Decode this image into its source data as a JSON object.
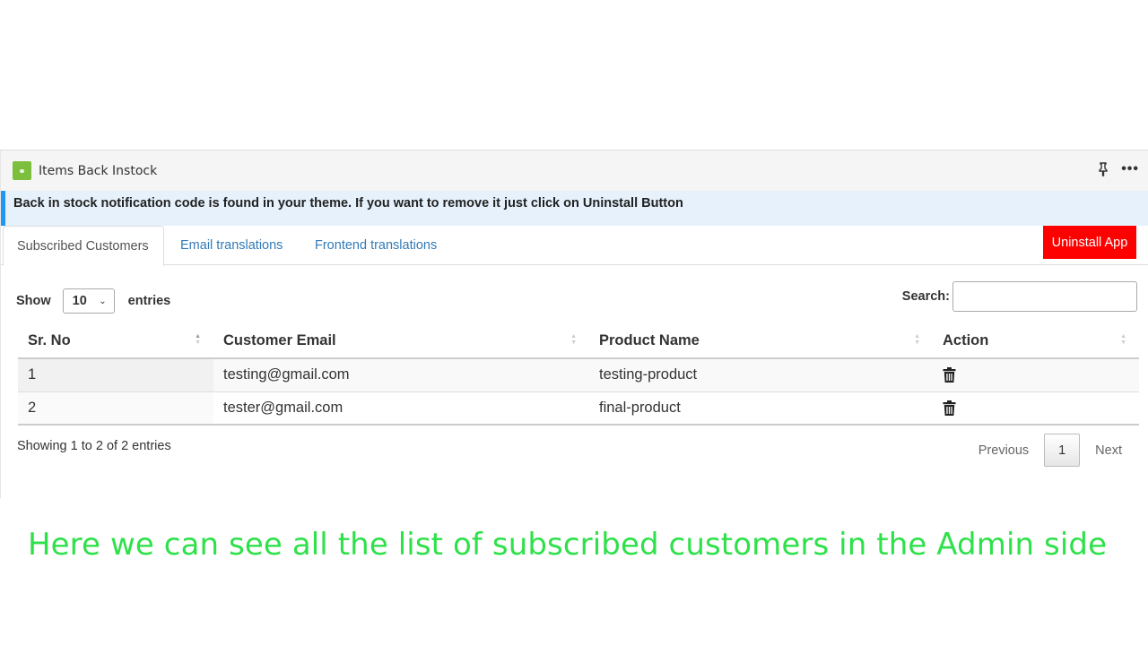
{
  "app": {
    "title": "Items Back Instock",
    "logo_icon": "leaf-logo",
    "header_icons": [
      "pin-icon",
      "more-options-icon"
    ],
    "more_glyph": "•••"
  },
  "notice": {
    "text": "Back in stock notification code is found in your theme. If you want to remove it just click on Uninstall Button",
    "accent_color": "#2196f3"
  },
  "tabs": [
    {
      "label": "Subscribed Customers",
      "active": true
    },
    {
      "label": "Email translations",
      "active": false
    },
    {
      "label": "Frontend translations",
      "active": false
    }
  ],
  "uninstall_button": {
    "label": "Uninstall App",
    "color": "#ff0000"
  },
  "length_control": {
    "show_label": "Show",
    "selected": "10",
    "entries_label": "entries"
  },
  "search": {
    "label": "Search:",
    "value": "",
    "placeholder": ""
  },
  "table": {
    "columns": [
      "Sr. No",
      "Customer Email",
      "Product Name",
      "Action"
    ],
    "rows": [
      {
        "sr_no": "1",
        "email": "testing@gmail.com",
        "product": "testing-product",
        "action_icon": "trash-icon"
      },
      {
        "sr_no": "2",
        "email": "tester@gmail.com",
        "product": "final-product",
        "action_icon": "trash-icon"
      }
    ]
  },
  "footer": {
    "info": "Showing 1 to 2 of 2 entries",
    "pagination": {
      "previous": "Previous",
      "current_page": "1",
      "next": "Next"
    }
  },
  "caption": {
    "text": "Here we can see all the list of subscribed customers in the Admin side",
    "color": "#2ee14a"
  }
}
